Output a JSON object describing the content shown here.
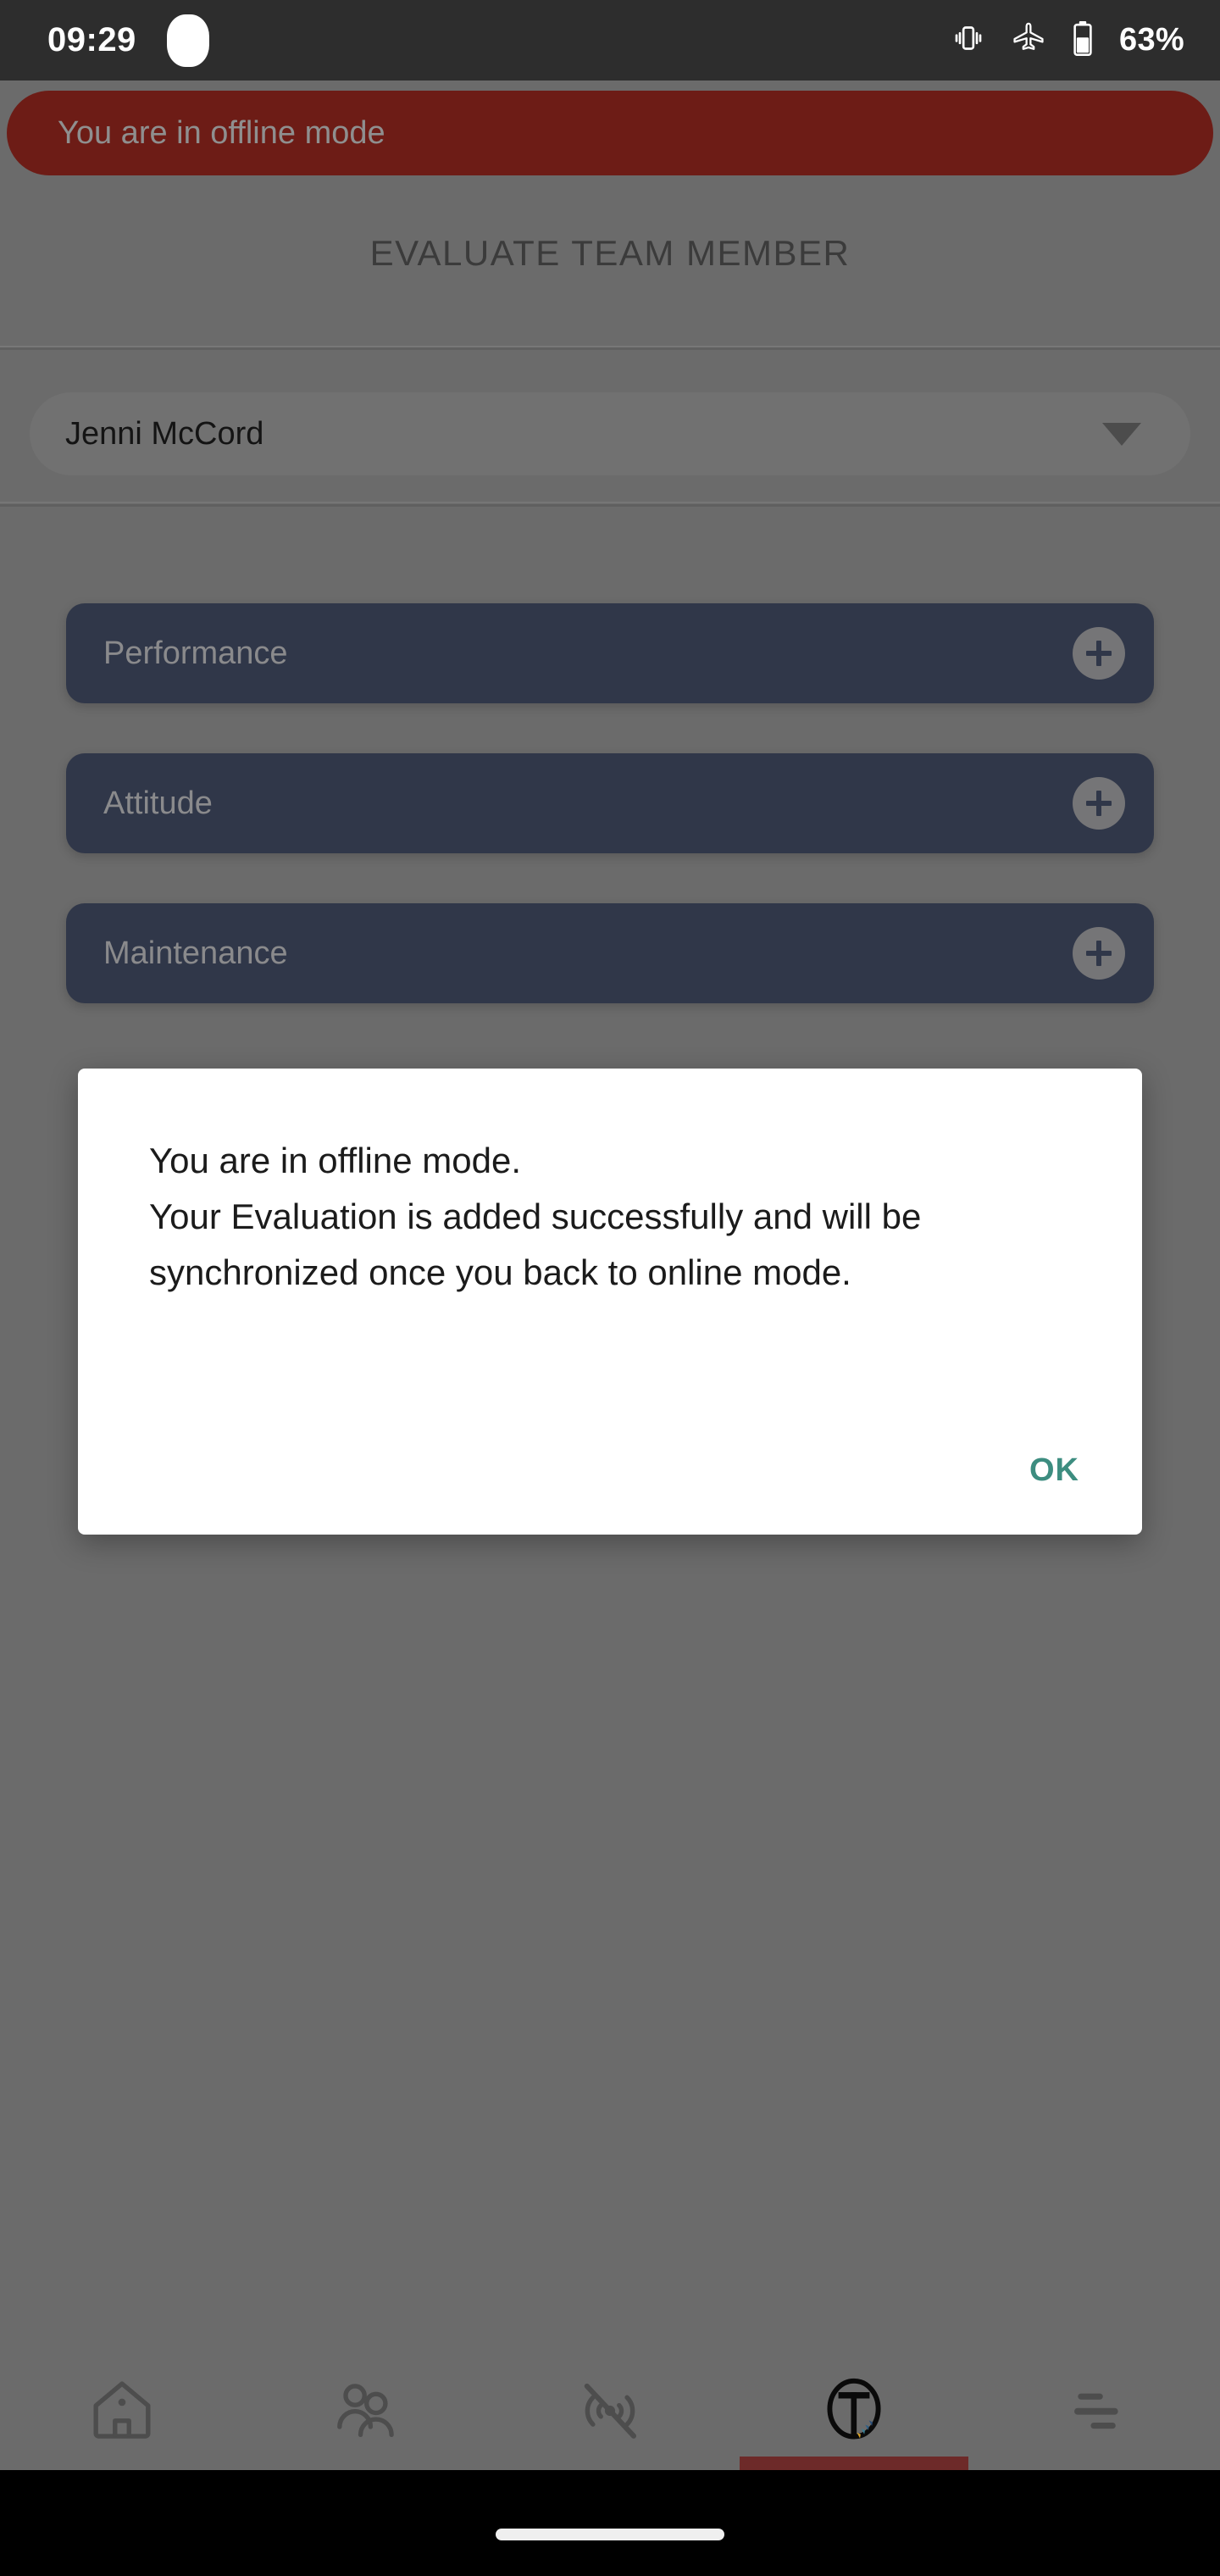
{
  "status_bar": {
    "time": "09:29",
    "battery_percent": "63%",
    "icons": [
      "camera-punch-hole",
      "vibrate-icon",
      "airplane-mode-icon",
      "battery-icon"
    ]
  },
  "offline_banner": {
    "text": "You are in offline mode",
    "background_color": "#6d1c16",
    "text_color": "#8f8f8f"
  },
  "header": {
    "title": "EVALUATE TEAM MEMBER"
  },
  "team_member_select": {
    "value": "Jenni McCord",
    "caret_icon": "chevron-down-icon"
  },
  "categories": [
    {
      "label": "Performance",
      "add_icon": "plus-icon"
    },
    {
      "label": "Attitude",
      "add_icon": "plus-icon"
    },
    {
      "label": "Maintenance",
      "add_icon": "plus-icon"
    }
  ],
  "dialog": {
    "message": "You are in offline mode.\nYour Evaluation is added successfully and will be synchronized once you back to online mode.",
    "ok_label": "OK",
    "ok_color": "#3d8d80"
  },
  "bottom_nav": {
    "active_index": 3,
    "accent_color": "#6d2a29",
    "items": [
      {
        "name": "home",
        "icon": "home-icon"
      },
      {
        "name": "team",
        "icon": "people-icon"
      },
      {
        "name": "offline",
        "icon": "signal-off-icon"
      },
      {
        "name": "evaluate",
        "icon": "t-logo-icon"
      },
      {
        "name": "menu",
        "icon": "filter-list-icon"
      }
    ]
  },
  "theme": {
    "page_background": "#6b6b6b",
    "card_background": "#303749",
    "status_bar_background": "#2d2d2d"
  }
}
